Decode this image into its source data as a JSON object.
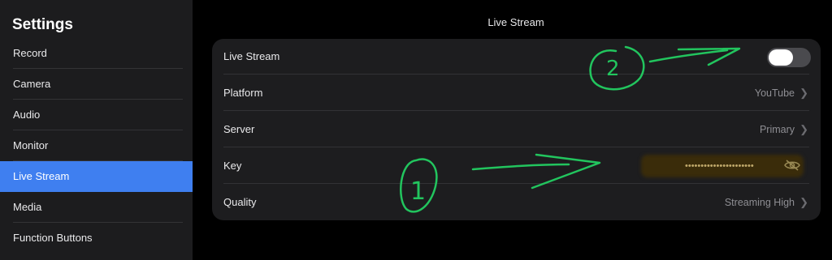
{
  "sidebar": {
    "title": "Settings",
    "items": [
      {
        "label": "Record"
      },
      {
        "label": "Camera"
      },
      {
        "label": "Audio"
      },
      {
        "label": "Monitor"
      },
      {
        "label": "Live Stream",
        "active": true
      },
      {
        "label": "Media"
      },
      {
        "label": "Function Buttons"
      }
    ]
  },
  "main": {
    "title": "Live Stream",
    "rows": {
      "live_stream": {
        "label": "Live Stream",
        "toggle_on": false
      },
      "platform": {
        "label": "Platform",
        "value": "YouTube"
      },
      "server": {
        "label": "Server",
        "value": "Primary"
      },
      "key": {
        "label": "Key",
        "masked_value": "••••••••••••••••••••••"
      },
      "quality": {
        "label": "Quality",
        "value": "Streaming High"
      }
    }
  },
  "annotations": {
    "circle_1": "1",
    "circle_2": "2"
  },
  "colors": {
    "accent": "#3f7ff0",
    "annotation": "#22c55e"
  }
}
